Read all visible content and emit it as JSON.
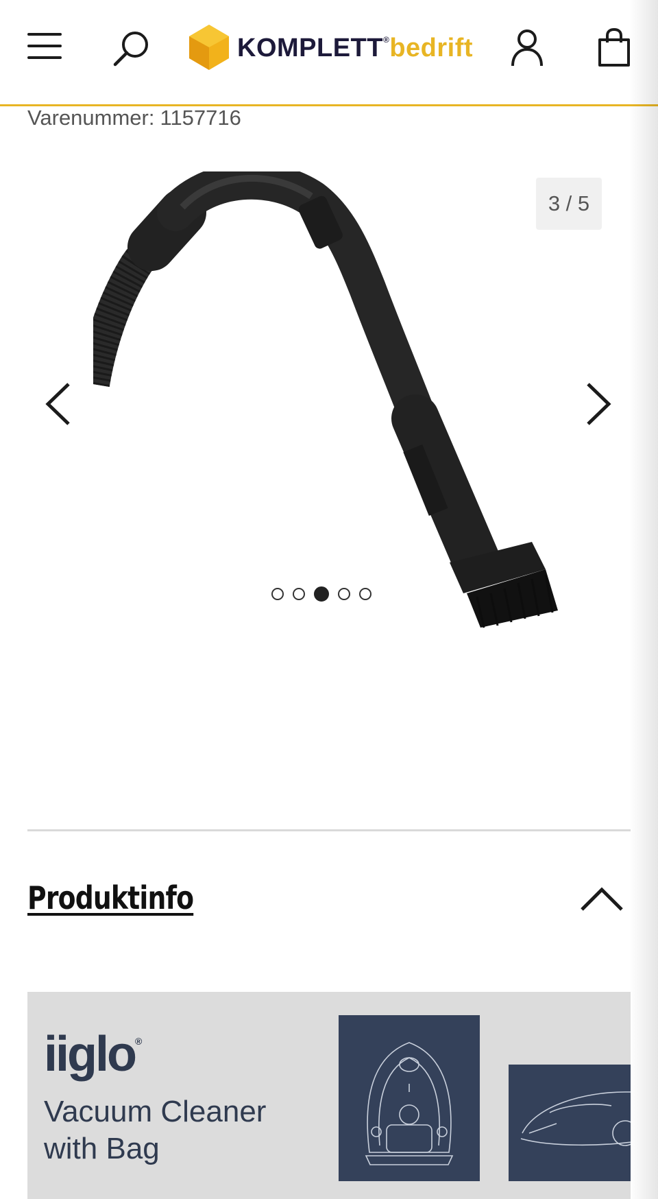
{
  "header": {
    "logo_brand": "KOMPLETT",
    "logo_reg": "®",
    "logo_suffix": "bedrift",
    "accent_color": "#e8b524",
    "icons": [
      "menu-icon",
      "search-icon",
      "account-icon",
      "cart-icon"
    ]
  },
  "product": {
    "item_number_label": "Varenummer:",
    "item_number_value": "1157716"
  },
  "gallery": {
    "counter": "3 / 5",
    "total_images": 5,
    "active_index": 3,
    "image_subject": "vacuum-hose-with-brush-nozzle",
    "icons": [
      "chevron-left-icon",
      "chevron-right-icon"
    ]
  },
  "section": {
    "title": "Produktinfo",
    "icon": "chevron-up-icon"
  },
  "banner": {
    "brand": "iiglo",
    "brand_reg": "®",
    "line1": "Vacuum Cleaner",
    "line2": "with Bag",
    "panel_color": "#34415a",
    "background_color": "#dcdcdc"
  }
}
